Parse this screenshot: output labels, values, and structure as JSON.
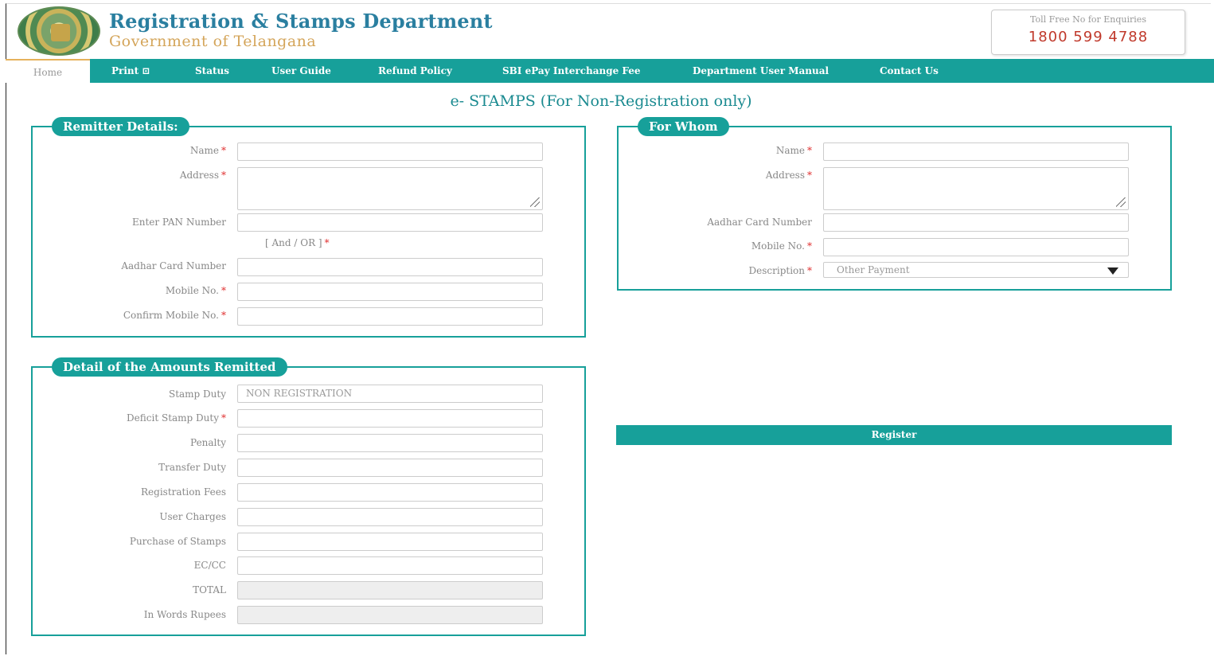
{
  "header": {
    "title": "Registration & Stamps Department",
    "subtitle": "Government of Telangana",
    "toll_label": "Toll Free No for Enquiries",
    "toll_number": "1800 599 4788"
  },
  "nav": {
    "items": [
      "Home",
      "Print ⊡",
      "Status",
      "User Guide",
      "Refund Policy",
      "SBI ePay Interchange Fee",
      "Department User Manual",
      "Contact Us"
    ]
  },
  "page_heading": "e- STAMPS (For Non-Registration only)",
  "remitter": {
    "legend": "Remitter Details:",
    "name_label": "Name",
    "address_label": "Address",
    "pan_label": "Enter PAN Number",
    "andor_label": "[ And / OR ]",
    "aadhar_label": "Aadhar Card Number",
    "mobile_label": "Mobile No.",
    "confirm_mobile_label": "Confirm Mobile No."
  },
  "for_whom": {
    "legend": "For Whom",
    "name_label": "Name",
    "address_label": "Address",
    "aadhar_label": "Aadhar Card Number",
    "mobile_label": "Mobile No.",
    "description_label": "Description",
    "description_value": "Other Payment"
  },
  "amounts": {
    "legend": "Detail of the Amounts Remitted",
    "stamp_duty_label": "Stamp Duty",
    "stamp_duty_value": "NON REGISTRATION",
    "deficit_label": "Deficit Stamp Duty",
    "penalty_label": "Penalty",
    "transfer_label": "Transfer Duty",
    "regfees_label": "Registration Fees",
    "usercharges_label": "User Charges",
    "purchase_label": "Purchase of Stamps",
    "eccc_label": "EC/CC",
    "total_label": "TOTAL",
    "inwords_label": "In Words Rupees"
  },
  "required_mark": "*",
  "register_label": "Register"
}
